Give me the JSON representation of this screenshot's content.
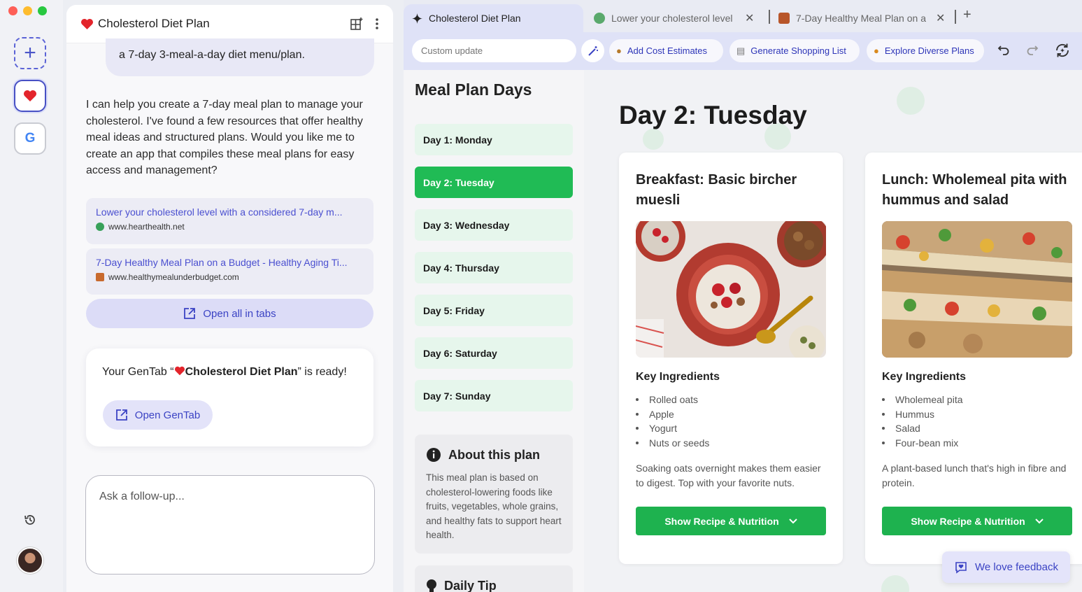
{
  "chat": {
    "title": "Cholesterol Diet Plan",
    "user_message": "a 7-day 3-meal-a-day diet menu/plan.",
    "assistant_message": "I can help you create a 7-day meal plan to manage your cholesterol. I've found a few resources that offer healthy meal ideas and structured plans. Would you like me to create an app that compiles these meal plans for easy access and management?",
    "sources": [
      {
        "title": "Lower your cholesterol level with a considered 7-day m...",
        "url": "www.hearthealth.net"
      },
      {
        "title": "7-Day Healthy Meal Plan on a Budget - Healthy Aging Ti...",
        "url": "www.healthymealunderbudget.com"
      }
    ],
    "open_all_label": "Open all in tabs",
    "ready_prefix": "Your GenTab “",
    "ready_name": "Cholesterol Diet Plan",
    "ready_suffix": "” is ready!",
    "open_gentab_label": "Open GenTab",
    "followup_placeholder": "Ask a follow-up..."
  },
  "browser": {
    "tabs": [
      {
        "label": "Cholesterol Diet Plan",
        "icon": "sparkle-icon"
      },
      {
        "label": "Lower your cholesterol level w",
        "icon": "globe-icon"
      },
      {
        "label": "7-Day Healthy Meal Plan on a",
        "icon": "site-icon"
      }
    ],
    "toolbar": {
      "custom_placeholder": "Custom update",
      "actions": [
        "Add Cost Estimates",
        "Generate Shopping List",
        "Explore Diverse Plans"
      ]
    }
  },
  "app": {
    "days_title": "Meal Plan Days",
    "days": [
      "Day 1: Monday",
      "Day 2: Tuesday",
      "Day 3: Wednesday",
      "Day 4: Thursday",
      "Day 5: Friday",
      "Day 6: Saturday",
      "Day 7: Sunday"
    ],
    "active_day_index": 1,
    "about_title": "About this plan",
    "about_body": "This meal plan is based on cholesterol-lowering foods like fruits, vegetables, whole grains, and healthy fats to support heart health.",
    "tip_title": "Daily Tip",
    "day_heading": "Day 2: Tuesday",
    "meals": [
      {
        "title": "Breakfast: Basic bircher muesli",
        "ingredients_label": "Key Ingredients",
        "ingredients": [
          "Rolled oats",
          "Apple",
          "Yogurt",
          "Nuts or seeds"
        ],
        "description": "Soaking oats overnight makes them easier to digest. Top with your favorite nuts.",
        "button": "Show Recipe & Nutrition"
      },
      {
        "title": "Lunch: Wholemeal pita with hummus and salad",
        "ingredients_label": "Key Ingredients",
        "ingredients": [
          "Wholemeal pita",
          "Hummus",
          "Salad",
          "Four-bean mix"
        ],
        "description": "A plant-based lunch that's high in fibre and protein.",
        "button": "Show Recipe & Nutrition"
      }
    ],
    "feedback_label": "We love feedback"
  }
}
